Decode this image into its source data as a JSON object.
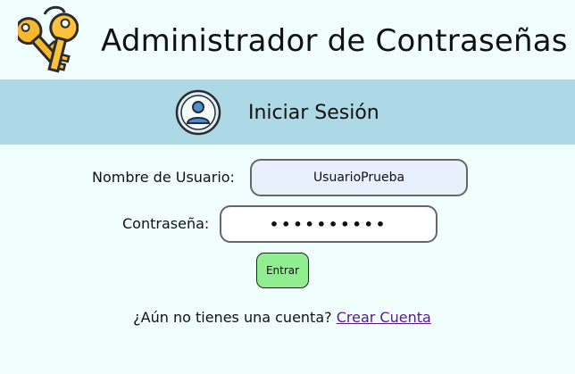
{
  "header": {
    "title": "Administrador de Contraseñas",
    "logo_icon": "keys-icon"
  },
  "banner": {
    "title": "Iniciar Sesión",
    "avatar_icon": "user-avatar-icon",
    "background": "#add8e6"
  },
  "form": {
    "username_label": "Nombre de Usuario:",
    "username_value": "UsuarioPrueba",
    "password_label": "Contraseña:",
    "password_value": "••••••••••",
    "submit_label": "Entrar",
    "submit_color": "#90ee90"
  },
  "footer": {
    "prompt": "¿Aún no tienes una cuenta?",
    "link_label": "Crear Cuenta"
  }
}
